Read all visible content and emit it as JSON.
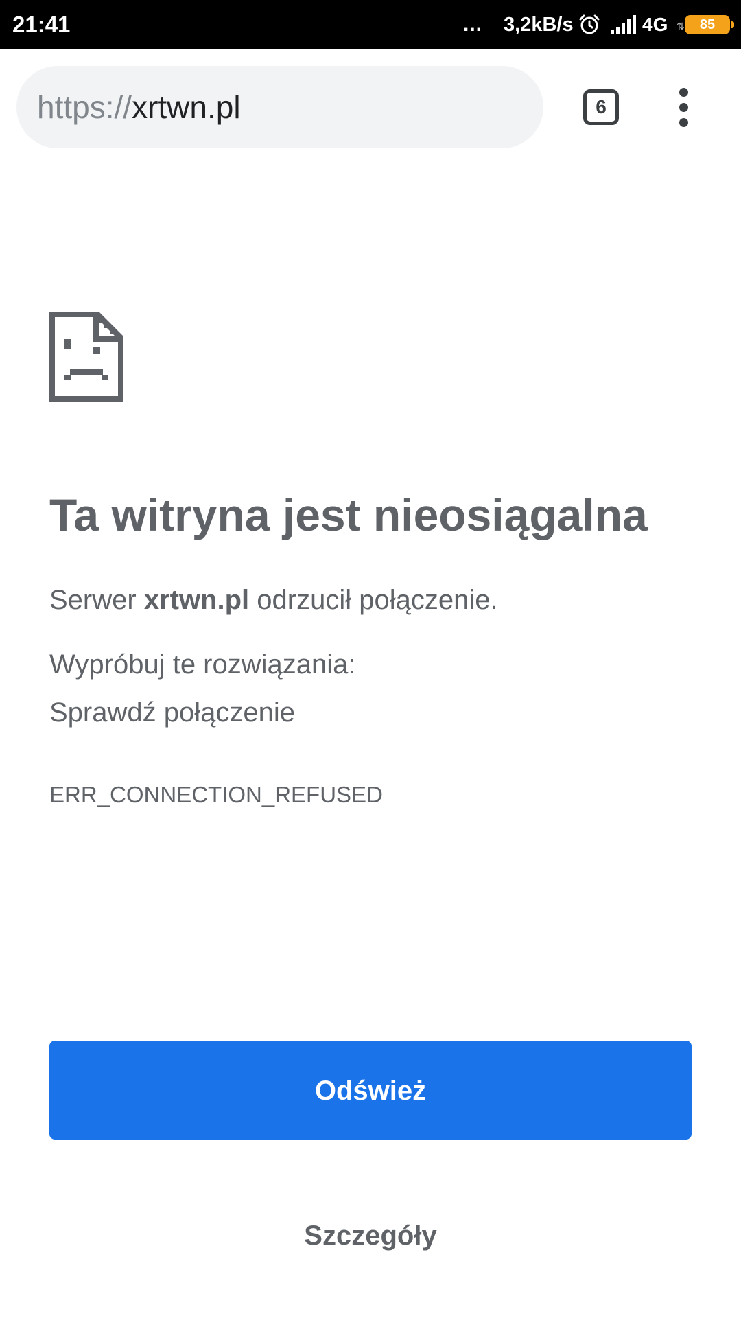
{
  "status_bar": {
    "time": "21:41",
    "dots": "...",
    "net_speed": "3,2kB/s",
    "network_type": "4G",
    "network_arrows": "⇅",
    "battery": "85",
    "battery_color": "#f3a21a",
    "icons": [
      "alarm-icon",
      "signal-icon",
      "battery-icon"
    ]
  },
  "toolbar": {
    "url_scheme": "https://",
    "url_host": "xrtwn.pl",
    "tab_count": "6",
    "menu_icon": "more-vert-icon"
  },
  "error": {
    "icon": "sad-page-icon",
    "title": "Ta witryna jest nieosiągalna",
    "desc_prefix": "Serwer ",
    "desc_host": "xrtwn.pl",
    "desc_suffix": " odrzucił połączenie.",
    "suggestions_heading": "Wypróbuj te rozwiązania:",
    "suggestions": [
      "Sprawdź połączenie"
    ],
    "code": "ERR_CONNECTION_REFUSED"
  },
  "actions": {
    "reload_label": "Odśwież",
    "details_label": "Szczegóły",
    "accent_color": "#1a73e8"
  }
}
